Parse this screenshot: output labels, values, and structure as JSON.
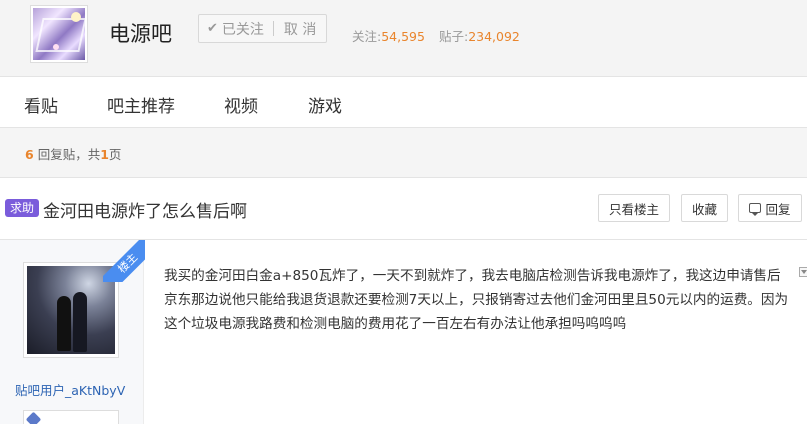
{
  "header": {
    "forum_name": "电源吧",
    "follow_label": "已关注",
    "cancel_label": "取 消",
    "followers_label": "关注:",
    "followers_count": "54,595",
    "posts_label": "贴子:",
    "posts_count": "234,092"
  },
  "nav": {
    "items": [
      {
        "label": "看贴"
      },
      {
        "label": "吧主推荐"
      },
      {
        "label": "视频"
      },
      {
        "label": "游戏"
      }
    ]
  },
  "reply_bar": {
    "reply_count": "6",
    "reply_text": "回复贴，共",
    "page_count": "1",
    "page_unit": "页"
  },
  "thread": {
    "badge": "求助",
    "title": "金河田电源炸了怎么售后啊",
    "buttons": {
      "only_op": "只看楼主",
      "favorite": "收藏",
      "reply": "回复"
    }
  },
  "post": {
    "op_ribbon": "楼主",
    "author": "贴吧用户_aKtNbyV",
    "content": "我买的金河田白金a+850瓦炸了，一天不到就炸了，我去电脑店检测告诉我电源炸了，我这边申请售后京东那边说他只能给我退货退款还要检测7天以上，只报销寄过去他们金河田里且50元以内的运费。因为这个垃圾电源我路费和检测电脑的费用花了一百左右有办法让他承担吗呜呜呜"
  },
  "colors": {
    "accent_orange": "#e9852d",
    "badge_purple": "#7a5cdb",
    "link_blue": "#2d64b3",
    "ribbon_blue": "#4a8df0"
  }
}
